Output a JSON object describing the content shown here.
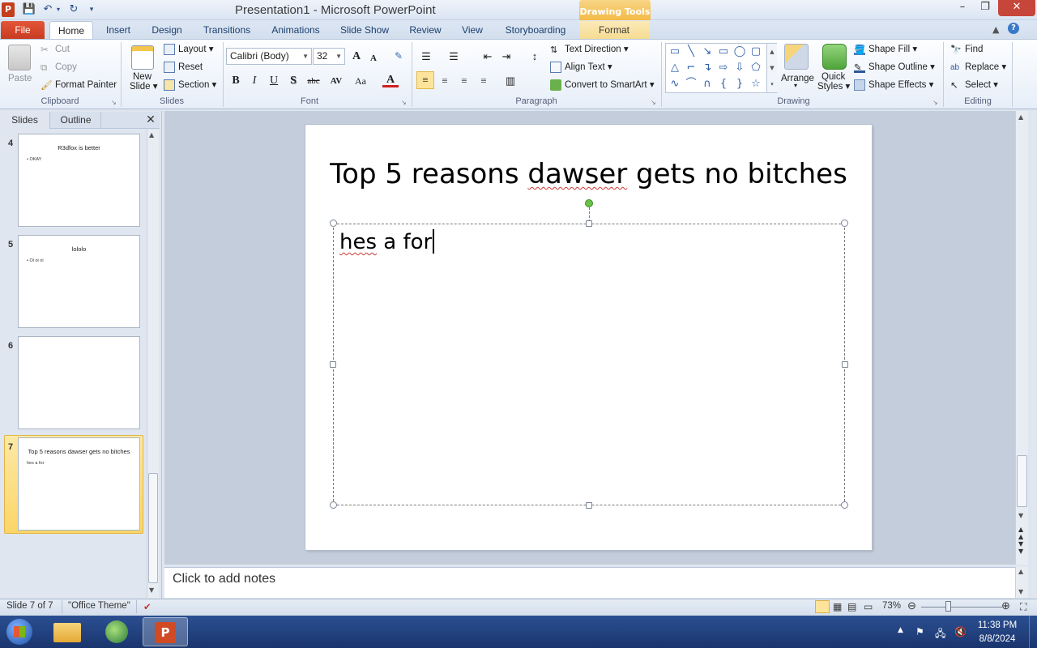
{
  "window": {
    "title": "Presentation1 - Microsoft PowerPoint",
    "contextual_tab_group": "Drawing Tools",
    "minimize": "–",
    "restore": "❐",
    "close": "✕"
  },
  "tabs": [
    "File",
    "Home",
    "Insert",
    "Design",
    "Transitions",
    "Animations",
    "Slide Show",
    "Review",
    "View",
    "Storyboarding",
    "Format"
  ],
  "ribbon": {
    "clipboard": {
      "label": "Clipboard",
      "paste": "Paste",
      "cut": "Cut",
      "copy": "Copy",
      "format_painter": "Format Painter"
    },
    "slides": {
      "label": "Slides",
      "new_slide_1": "New",
      "new_slide_2": "Slide",
      "layout": "Layout",
      "reset": "Reset",
      "section": "Section"
    },
    "font": {
      "label": "Font",
      "font_name": "Calibri (Body)",
      "font_size": "32",
      "bold": "B",
      "italic": "I",
      "underline": "U",
      "shadow": "S",
      "strike": "abc",
      "spacing": "AV",
      "case": "Aa",
      "color": "A",
      "grow": "A",
      "shrink": "A"
    },
    "paragraph": {
      "label": "Paragraph",
      "text_direction": "Text Direction",
      "align_text": "Align Text",
      "convert_smartart": "Convert to SmartArt"
    },
    "drawing": {
      "label": "Drawing",
      "arrange": "Arrange",
      "quick_styles_1": "Quick",
      "quick_styles_2": "Styles",
      "shape_fill": "Shape Fill",
      "shape_outline": "Shape Outline",
      "shape_effects": "Shape Effects"
    },
    "editing": {
      "label": "Editing",
      "find": "Find",
      "replace": "Replace",
      "select": "Select"
    }
  },
  "slide_panel": {
    "tabs": [
      "Slides",
      "Outline"
    ],
    "close": "✕",
    "thumbnails": [
      {
        "number": "4",
        "title": "R3dfox is better",
        "bullet": "• OKAY"
      },
      {
        "number": "5",
        "title": "lololo",
        "bullet": "• Oi oi oi"
      },
      {
        "number": "6",
        "title": "",
        "bullet": ""
      },
      {
        "number": "7",
        "title": "Top 5 reasons dawser gets no bitches",
        "bullet": "hes a for"
      }
    ]
  },
  "slide": {
    "title_parts": [
      "Top 5 reasons ",
      "dawser",
      " gets no bitches"
    ],
    "content_parts": [
      "hes",
      " a for"
    ]
  },
  "notes": {
    "placeholder": "Click to add notes"
  },
  "status": {
    "slide_info": "Slide 7 of 7",
    "theme": "\"Office Theme\"",
    "zoom": "73%"
  },
  "taskbar": {
    "time": "11:38 PM",
    "date": "8/8/2024"
  },
  "colors": {
    "file_tab": "#c73b20",
    "accent": "#2b5797",
    "selected_thumb": "#fbd567",
    "spell_underline": "#d23a3a"
  }
}
